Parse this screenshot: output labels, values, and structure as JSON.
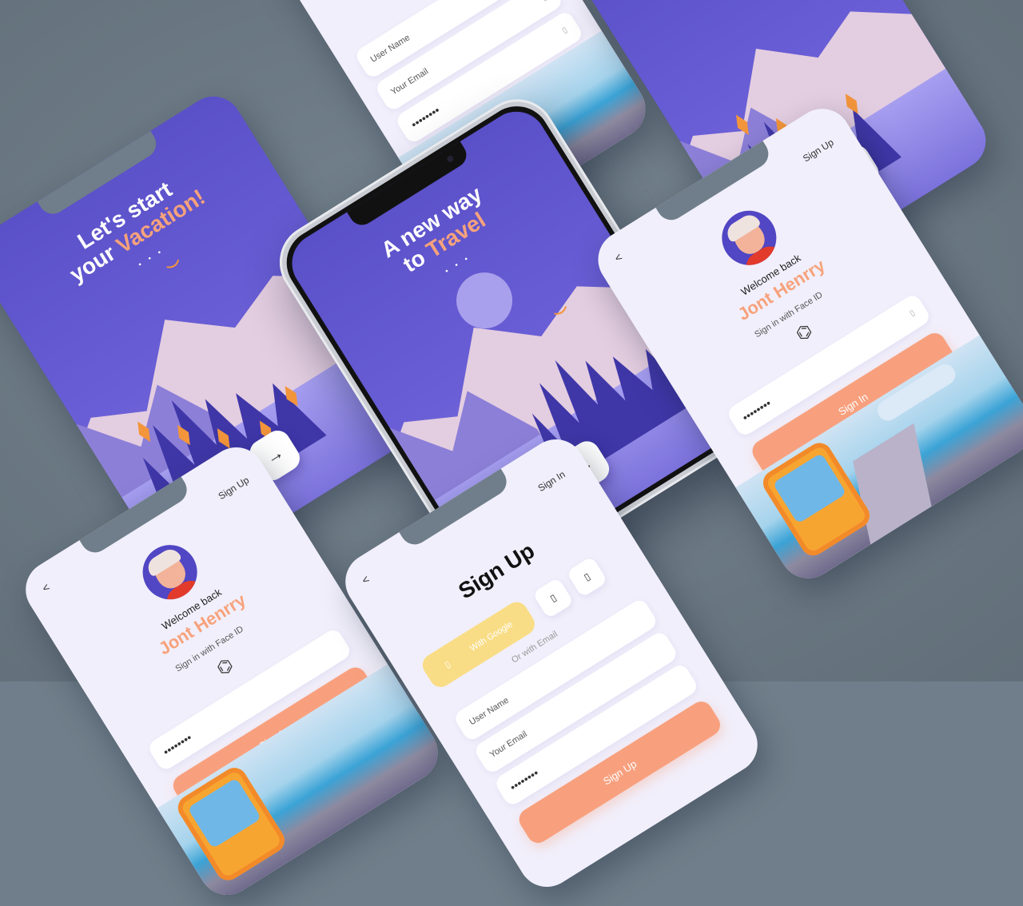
{
  "screens": {
    "vacation": {
      "title_line1": "Let's start",
      "title_line2a": "your ",
      "title_line2b": "Vacation!",
      "dots": "• • •",
      "next": "→"
    },
    "travel": {
      "title_line1": "A new way",
      "title_line2a": "to ",
      "title_line2b": "Travel",
      "dots": "• • •",
      "next": "→"
    },
    "signin": {
      "back": "<",
      "top_link": "Sign Up",
      "welcome": "Welcome back",
      "name": "Jont Henrry",
      "face_id_hint": "Sign in with Face ID",
      "password_mask": "••••••••",
      "cta": "Sign In"
    },
    "signup": {
      "back": "<",
      "top_link": "Sign In",
      "title": "Sign Up",
      "google": "With Google",
      "or_email": "Or with Email",
      "user_name": "User Name",
      "your_email": "Your Email",
      "password_mask": "••••••••",
      "cta": "Sign Up"
    }
  },
  "colors": {
    "background": "#6f7e8a",
    "purple": "#5b52c9",
    "accent": "#f7a27c",
    "google": "#f9dd86",
    "light": "#f1effb"
  },
  "icons": [
    "arrow-right-icon",
    "chevron-left-icon",
    "face-id-icon",
    "bird-icon"
  ]
}
